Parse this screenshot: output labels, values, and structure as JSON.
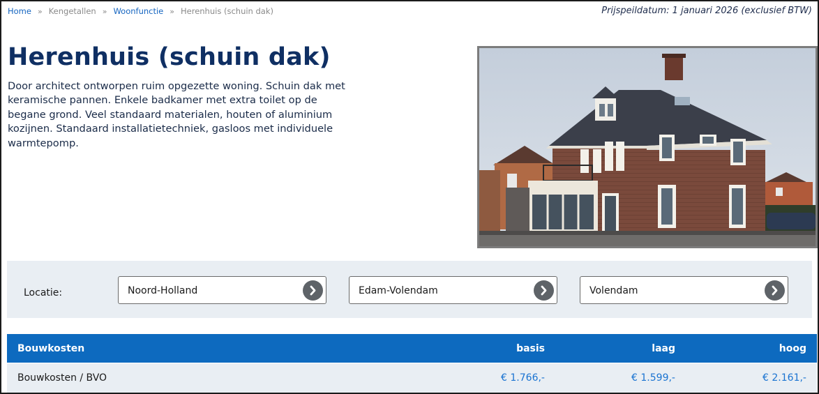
{
  "breadcrumb": {
    "home": "Home",
    "sep": "»",
    "kengetallen": "Kengetallen",
    "woonfunctie": "Woonfunctie",
    "current": "Herenhuis (schuin dak)"
  },
  "price_date": "Prijspeildatum: 1 januari 2026 (exclusief BTW)",
  "title": "Herenhuis (schuin dak)",
  "description": "Door architect ontworpen ruim opgezette woning. Schuin dak met keramische pannen. Enkele badkamer met extra toilet op de begane grond. Veel standaard materialen, houten of aluminium kozijnen. Standaard installatietechniek, gasloos met individuele warmtepomp.",
  "location": {
    "label": "Locatie:",
    "province": "Noord-Holland",
    "municipality": "Edam-Volendam",
    "place": "Volendam"
  },
  "table": {
    "headers": [
      "Bouwkosten",
      "basis",
      "laag",
      "hoog"
    ],
    "rows": [
      [
        "Bouwkosten / BVO",
        "€ 1.766,-",
        "€ 1.599,-",
        "€ 2.161,-"
      ]
    ]
  },
  "icons": {
    "select_arrow": "chevron-right-icon"
  },
  "colors": {
    "primary": "#0d6abf",
    "title": "#0f2f63",
    "band": "#e9eef3",
    "link": "#1565c0"
  }
}
